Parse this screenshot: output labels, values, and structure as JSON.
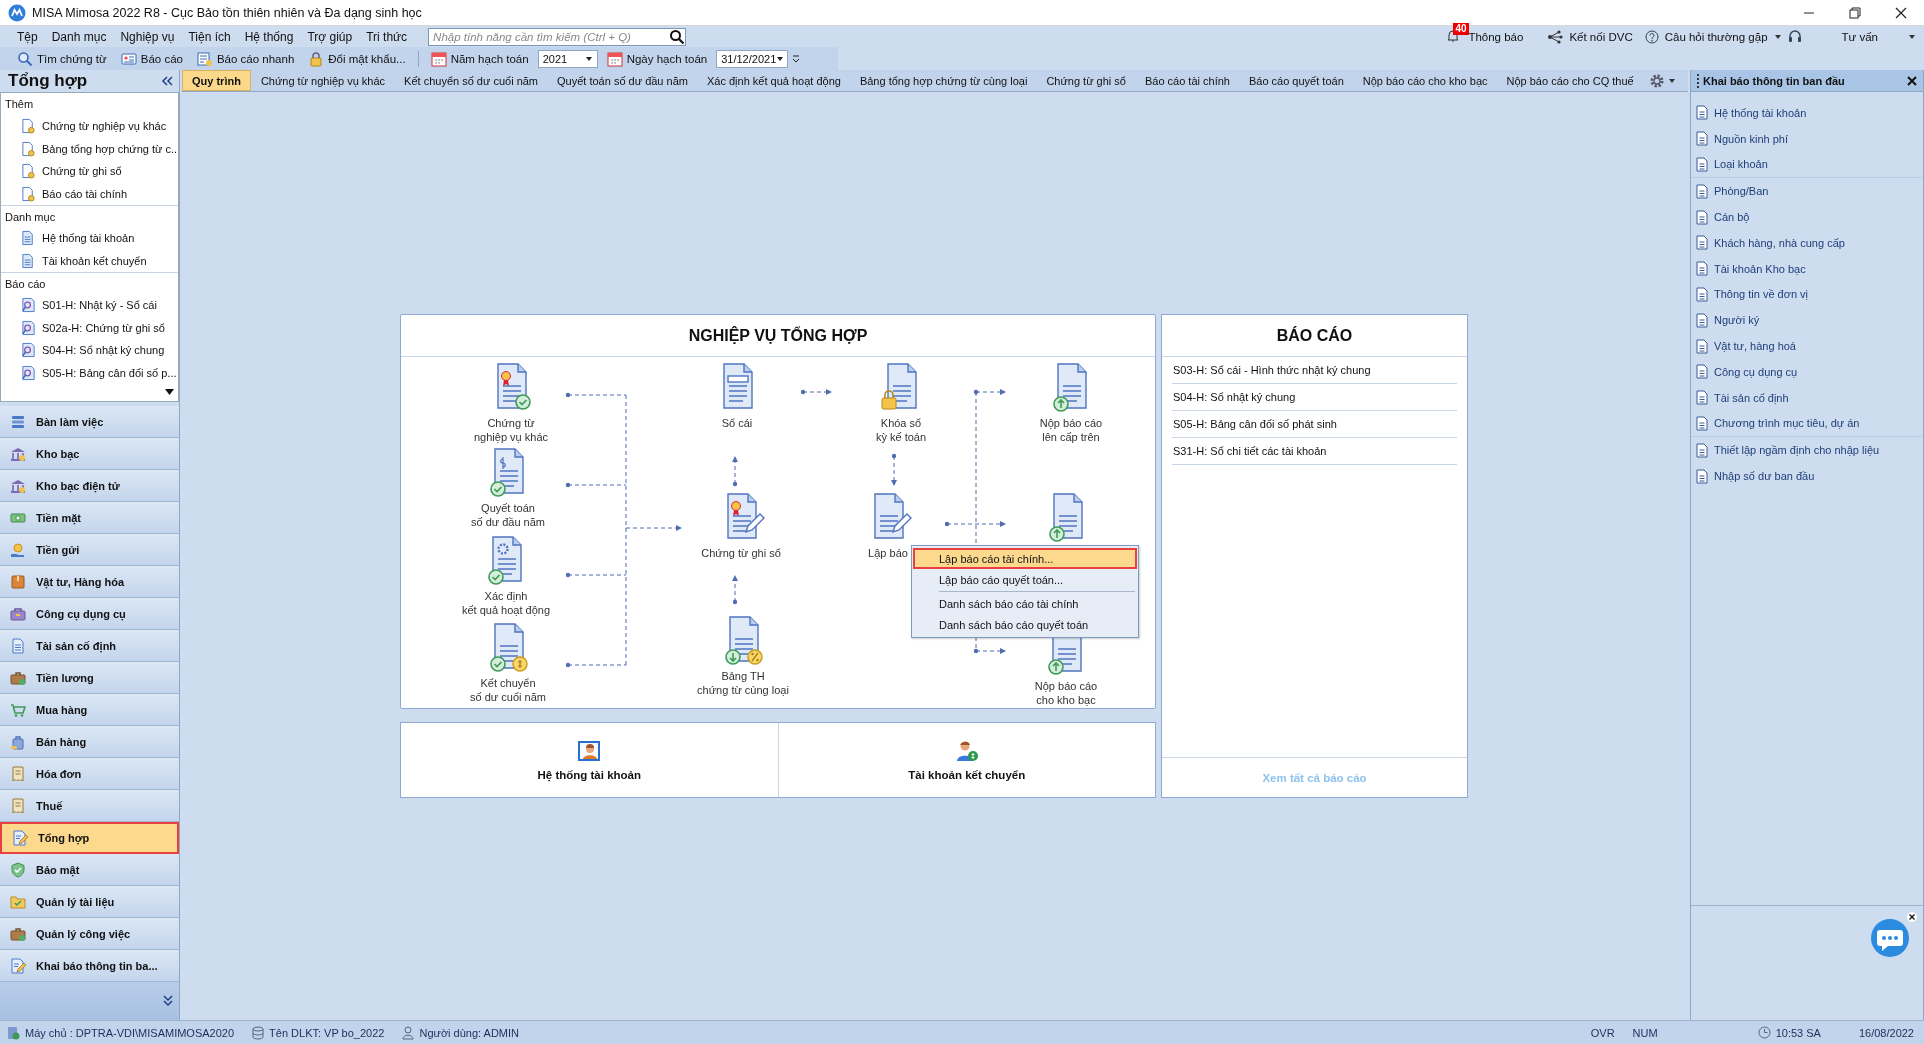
{
  "window": {
    "title": "MISA Mimosa 2022 R8 - Cục Bảo tồn thiên nhiên và Đa dạng sinh học"
  },
  "menu_bar": {
    "items": [
      "Tệp",
      "Danh mục",
      "Nghiệp vụ",
      "Tiện ích",
      "Hệ thống",
      "Trợ giúp",
      "Tri thức"
    ],
    "search": {
      "placeholder": "Nhập tính năng cần tìm kiếm (Ctrl + Q)"
    },
    "notifications": {
      "label": "Thông báo",
      "badge": "40"
    },
    "connect": "Kết nối DVC",
    "faq": "Câu hỏi thường gặp",
    "support": "Tư vấn"
  },
  "toolbar": {
    "buttons": [
      "Tìm chứng từ",
      "Báo cáo",
      "Báo cáo nhanh",
      "Đổi mật khẩu..."
    ],
    "year_label": "Năm hạch toán",
    "year": "2021",
    "date_label": "Ngày hạch toán",
    "date": "31/12/2021"
  },
  "sidebar": {
    "title": "Tổng hợp",
    "sections": [
      {
        "heading": "Thêm",
        "kind": "add",
        "items": [
          "Chứng từ nghiệp vụ khác",
          "Bảng tổng hợp chứng từ c...",
          "Chứng từ ghi sổ",
          "Báo cáo tài chính"
        ]
      },
      {
        "heading": "Danh mục",
        "kind": "catalog",
        "items": [
          "Hệ thống tài khoản",
          "Tài khoản kết chuyển"
        ]
      },
      {
        "heading": "Báo cáo",
        "kind": "report",
        "items": [
          "S01-H: Nhật ký - Sổ cái",
          "S02a-H: Chứng từ ghi sổ",
          "S04-H: Sổ nhật ký chung",
          "S05-H: Bảng cân đối số p..."
        ]
      }
    ],
    "nav": [
      {
        "label": "Bàn làm việc",
        "selected": false
      },
      {
        "label": "Kho bạc",
        "selected": false
      },
      {
        "label": "Kho bạc điện tử",
        "selected": false
      },
      {
        "label": "Tiền mặt",
        "selected": false
      },
      {
        "label": "Tiền gửi",
        "selected": false
      },
      {
        "label": "Vật tư, Hàng hóa",
        "selected": false
      },
      {
        "label": "Công cụ dụng cụ",
        "selected": false
      },
      {
        "label": "Tài sản cố định",
        "selected": false
      },
      {
        "label": "Tiền lương",
        "selected": false
      },
      {
        "label": "Mua hàng",
        "selected": false
      },
      {
        "label": "Bán hàng",
        "selected": false
      },
      {
        "label": "Hóa đơn",
        "selected": false
      },
      {
        "label": "Thuế",
        "selected": false
      },
      {
        "label": "Tổng hợp",
        "selected": true
      },
      {
        "label": "Bảo mật",
        "selected": false
      },
      {
        "label": "Quản lý tài liệu",
        "selected": false
      },
      {
        "label": "Quản lý công việc",
        "selected": false
      },
      {
        "label": "Khai báo thông tin ba...",
        "selected": false
      }
    ]
  },
  "tabs": [
    {
      "label": "Quy trình",
      "selected": true
    },
    {
      "label": "Chứng từ nghiệp vụ khác",
      "selected": false
    },
    {
      "label": "Kết chuyển số dư cuối năm",
      "selected": false
    },
    {
      "label": "Quyết toán số dư đầu năm",
      "selected": false
    },
    {
      "label": "Xác định kết quả hoạt động",
      "selected": false
    },
    {
      "label": "Bảng tổng hợp chứng từ cùng loại",
      "selected": false
    },
    {
      "label": "Chứng từ ghi sổ",
      "selected": false
    },
    {
      "label": "Báo cáo tài chính",
      "selected": false
    },
    {
      "label": "Báo cáo quyết toán",
      "selected": false
    },
    {
      "label": "Nộp báo cáo cho kho bạc",
      "selected": false
    },
    {
      "label": "Nộp báo cáo cho CQ thuế",
      "selected": false
    }
  ],
  "diagram": {
    "title": "NGHIỆP VỤ TỔNG HỢP",
    "nodes": [
      {
        "label": [
          "Chứng từ",
          "nghiệp vụ khác"
        ]
      },
      {
        "label": [
          "Quyết toán",
          "số dư đầu năm"
        ]
      },
      {
        "label": [
          "Xác định",
          "kết quả hoạt động"
        ]
      },
      {
        "label": [
          "Kết chuyển",
          "số dư cuối năm"
        ]
      },
      {
        "label": [
          "Sổ cái"
        ]
      },
      {
        "label": [
          "Chứng từ ghi sổ"
        ]
      },
      {
        "label": [
          "Bảng TH",
          "chứng từ cùng loại"
        ]
      },
      {
        "label": [
          "Khóa sổ",
          "kỳ kế toán"
        ]
      },
      {
        "label": [
          "Lập báo"
        ]
      },
      {
        "label": [
          "Nộp báo cáo",
          "lên cấp trên"
        ]
      },
      {
        "label": [
          "Nộp báo cáo",
          "cho kho bạc"
        ]
      }
    ],
    "context_menu": {
      "items": [
        {
          "label": "Lập báo cáo tài chính...",
          "selected": true
        },
        {
          "label": "Lập báo cáo quyết toán...",
          "selected": false
        },
        {
          "label": "Danh sách báo cáo tài chính",
          "selected": false
        },
        {
          "label": "Danh sách báo cáo quyết toán",
          "selected": false
        }
      ]
    }
  },
  "shortcuts": [
    "Hệ thống tài khoản",
    "Tài khoản kết chuyển"
  ],
  "reports": {
    "title": "BÁO CÁO",
    "items": [
      "S03-H: Sổ cái - Hình thức nhật ký chung",
      "S04-H: Sổ nhật ký chung",
      "S05-H: Bảng cân đối số phát sinh",
      "S31-H: Sổ chi tiết các tài khoản"
    ],
    "footer_link": "Xem tất cả báo cáo"
  },
  "right_panel": {
    "title": "Khai báo thông tin ban đầu",
    "groups": [
      [
        "Hệ thống tài khoản",
        "Nguồn kinh phí",
        "Loại khoản"
      ],
      [
        "Phòng/Ban",
        "Cán bộ",
        "Khách hàng, nhà cung cấp",
        "Tài khoản Kho bạc",
        "Thông tin về đơn vị",
        "Người ký",
        "Vật tư, hàng hoá",
        "Công cụ dụng cụ",
        "Tài sản cố định",
        "Chương trình mục tiêu, dự án"
      ],
      [
        "Thiết lập ngầm định cho nhập liệu",
        "Nhập số dư ban đầu"
      ]
    ]
  },
  "status_bar": {
    "server": "Máy chủ : DPTRA-VDI\\MISAMIMOSA2020",
    "database": "Tên DLKT: VP bo_2022",
    "user": "Người dùng: ADMIN",
    "ovr": "OVR",
    "num": "NUM",
    "time": "10:53 SA",
    "date": "16/08/2022"
  }
}
